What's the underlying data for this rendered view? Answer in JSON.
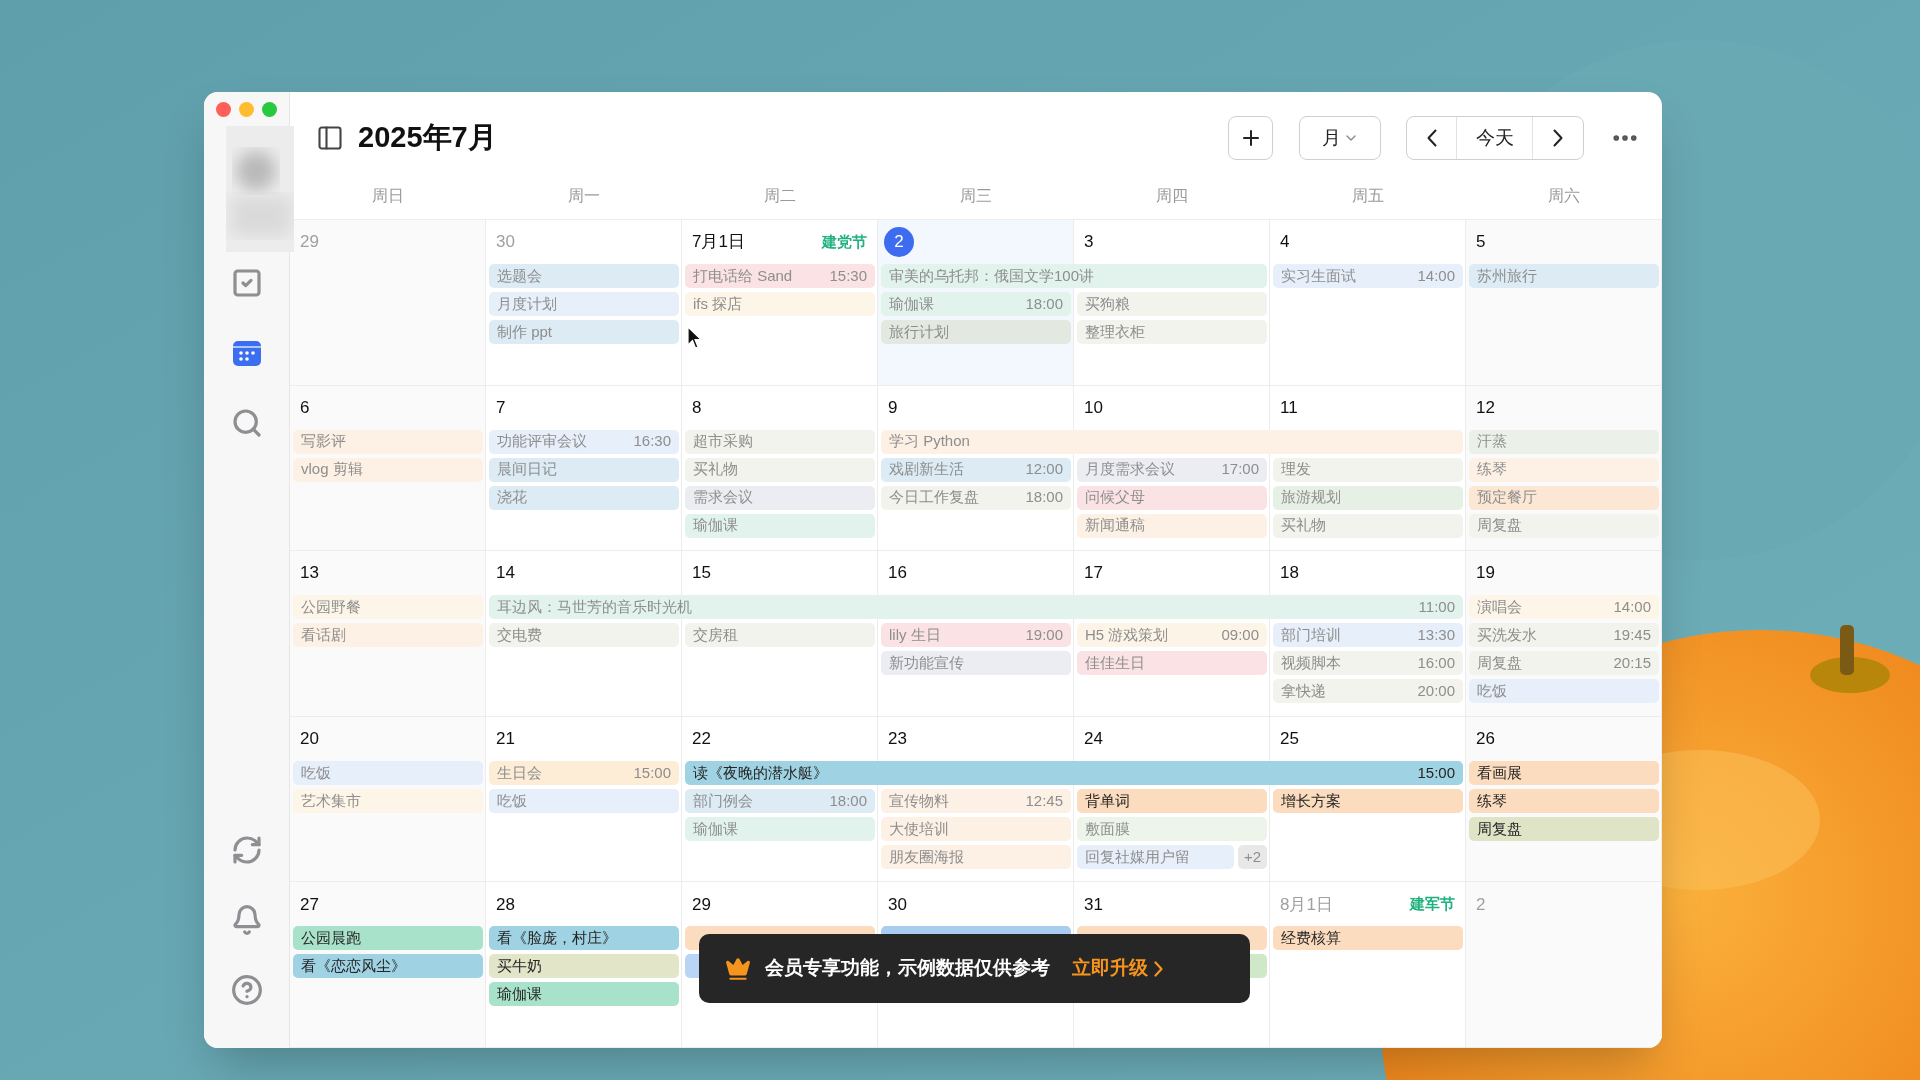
{
  "title": "2025年7月",
  "toolbar": {
    "view": "月",
    "today": "今天"
  },
  "sidebar": {
    "items": [
      {
        "kind": "tasks",
        "selected": false
      },
      {
        "kind": "calendar",
        "selected": true
      },
      {
        "kind": "search",
        "selected": false
      }
    ],
    "bottom": [
      {
        "kind": "sync"
      },
      {
        "kind": "bell"
      },
      {
        "kind": "help"
      }
    ]
  },
  "weekdays": [
    "周日",
    "周一",
    "周二",
    "周三",
    "周四",
    "周五",
    "周六"
  ],
  "weeks": [
    {
      "bands": [
        {
          "title": "审美的乌托邦：俄国文学100讲",
          "color": "#e1f3ec",
          "done": true,
          "covers": [
            false,
            false,
            false,
            true,
            true,
            false,
            false
          ]
        }
      ],
      "days": [
        {
          "date": "29",
          "muted": true
        },
        {
          "date": "30",
          "muted": true,
          "events": [
            {
              "title": "选题会",
              "color": "#dcebf4",
              "done": true
            },
            {
              "title": "月度计划",
              "color": "#e6effa",
              "done": true
            },
            {
              "title": "制作 ppt",
              "color": "#dcebf4",
              "done": true
            }
          ]
        },
        {
          "date": "7月1日",
          "muted": false,
          "holiday": "建党节",
          "events": [
            {
              "title": "打电话给 Sand",
              "time": "15:30",
              "color": "#fbe3e5",
              "done": true
            },
            {
              "title": "ifs 探店",
              "color": "#fdf6e8",
              "done": true
            }
          ]
        },
        {
          "date": "2",
          "muted": false,
          "today": true,
          "events": [
            {
              "title": "瑜伽课",
              "time": "18:00",
              "color": "#e1f3ec",
              "done": true
            },
            {
              "title": "旅行计划",
              "color": "#e3e9e1",
              "done": true
            }
          ]
        },
        {
          "date": "3",
          "muted": false,
          "events": [
            {
              "title": "买狗粮",
              "color": "#f1f3ec",
              "done": true
            },
            {
              "title": "整理衣柜",
              "color": "#f1f3ec",
              "done": true
            }
          ]
        },
        {
          "date": "4",
          "muted": false,
          "events": [
            {
              "title": "实习生面试",
              "time": "14:00",
              "color": "#e6effa",
              "done": true
            }
          ]
        },
        {
          "date": "5",
          "muted": false,
          "events": [
            {
              "title": "苏州旅行",
              "color": "#dcebf4",
              "done": true
            }
          ]
        }
      ]
    },
    {
      "bands": [
        {
          "title": "学习 Python",
          "color": "#fdf1e6",
          "done": true,
          "covers": [
            false,
            false,
            false,
            true,
            true,
            true,
            false
          ]
        }
      ],
      "days": [
        {
          "date": "6",
          "muted": false,
          "events": [
            {
              "title": "写影评",
              "color": "#fdf1e6",
              "done": true
            },
            {
              "title": "vlog 剪辑",
              "color": "#fdf1e6",
              "done": true
            }
          ]
        },
        {
          "date": "7",
          "muted": false,
          "events": [
            {
              "title": "功能评审会议",
              "time": "16:30",
              "color": "#e6effa",
              "done": true
            },
            {
              "title": "晨间日记",
              "color": "#dcebf4",
              "done": true
            },
            {
              "title": "浇花",
              "color": "#dcebf4",
              "done": true
            }
          ]
        },
        {
          "date": "8",
          "muted": false,
          "events": [
            {
              "title": "超市采购",
              "color": "#f1f3ec",
              "done": true
            },
            {
              "title": "买礼物",
              "color": "#f1f3ec",
              "done": true
            },
            {
              "title": "需求会议",
              "color": "#ecedf2",
              "done": true
            },
            {
              "title": "瑜伽课",
              "color": "#e1f3ec",
              "done": true
            }
          ]
        },
        {
          "date": "9",
          "muted": false,
          "events": [
            {
              "title": "戏剧新生活",
              "time": "12:00",
              "color": "#dcebf4",
              "done": true
            },
            {
              "title": "今日工作复盘",
              "time": "18:00",
              "color": "#f1f3ec",
              "done": true
            }
          ]
        },
        {
          "date": "10",
          "muted": false,
          "events": [
            {
              "title": "月度需求会议",
              "time": "17:00",
              "color": "#ecedf2",
              "done": true
            },
            {
              "title": "问候父母",
              "color": "#fbe3e5",
              "done": true
            },
            {
              "title": "新闻通稿",
              "color": "#fdf1e6",
              "done": true
            }
          ]
        },
        {
          "date": "11",
          "muted": false,
          "events": [
            {
              "title": "理发",
              "color": "#f1f3ec",
              "done": true
            },
            {
              "title": "旅游规划",
              "color": "#e7f0e5",
              "done": true
            },
            {
              "title": "买礼物",
              "color": "#f1f3ec",
              "done": true
            }
          ]
        },
        {
          "date": "12",
          "muted": false,
          "events": [
            {
              "title": "汗蒸",
              "color": "#ebf1e8",
              "done": true
            },
            {
              "title": "练琴",
              "color": "#fdf1e6",
              "done": true
            },
            {
              "title": "预定餐厅",
              "color": "#fce7d4",
              "done": true
            },
            {
              "title": "周复盘",
              "color": "#f1f3ec",
              "done": true
            }
          ]
        }
      ]
    },
    {
      "bands": [
        {
          "title": "耳边风：马世芳的音乐时光机",
          "time": "11:00",
          "color": "#e1f3ec",
          "done": true,
          "covers": [
            false,
            true,
            true,
            true,
            true,
            true,
            false
          ]
        }
      ],
      "days": [
        {
          "date": "13",
          "muted": false,
          "events": [
            {
              "title": "公园野餐",
              "color": "#fdf6e8",
              "done": true
            },
            {
              "title": "看话剧",
              "color": "#fdf1e6",
              "done": true
            }
          ]
        },
        {
          "date": "14",
          "muted": false,
          "events": [
            {
              "title": "交电费",
              "color": "#f1f3ec",
              "done": true
            }
          ]
        },
        {
          "date": "15",
          "muted": false,
          "events": [
            {
              "title": "交房租",
              "color": "#f1f3ec",
              "done": true
            }
          ]
        },
        {
          "date": "16",
          "muted": false,
          "events": [
            {
              "title": "lily 生日",
              "time": "19:00",
              "color": "#fbe3e5",
              "done": true
            },
            {
              "title": "新功能宣传",
              "color": "#ecedf2",
              "done": true
            }
          ]
        },
        {
          "date": "17",
          "muted": false,
          "events": [
            {
              "title": "H5 游戏策划",
              "time": "09:00",
              "color": "#fdf4e8",
              "done": true
            },
            {
              "title": "佳佳生日",
              "color": "#fbe3e5",
              "done": true
            }
          ]
        },
        {
          "date": "18",
          "muted": false,
          "events": [
            {
              "title": "部门培训",
              "time": "13:30",
              "color": "#e6effa",
              "done": true
            },
            {
              "title": "视频脚本",
              "time": "16:00",
              "color": "#f1f3ec",
              "done": true
            },
            {
              "title": "拿快递",
              "time": "20:00",
              "color": "#f1f3ec",
              "done": true
            }
          ]
        },
        {
          "date": "19",
          "muted": false,
          "events": [
            {
              "title": "演唱会",
              "time": "14:00",
              "color": "#fdf6e8",
              "done": true
            },
            {
              "title": "买洗发水",
              "time": "19:45",
              "color": "#f1f3ec",
              "done": true
            },
            {
              "title": "周复盘",
              "time": "20:15",
              "color": "#f1f3ec",
              "done": true
            },
            {
              "title": "吃饭",
              "color": "#e6effa",
              "done": true
            }
          ]
        }
      ]
    },
    {
      "bands": [
        {
          "title": "读《夜晚的潜水艇》",
          "time": "15:00",
          "color": "#9fd2e2",
          "done": false,
          "covers": [
            false,
            false,
            true,
            true,
            true,
            true,
            false
          ]
        }
      ],
      "days": [
        {
          "date": "20",
          "muted": false,
          "events": [
            {
              "title": "吃饭",
              "color": "#e6effa",
              "done": true
            },
            {
              "title": "艺术集市",
              "color": "#fdf6e8",
              "done": true
            }
          ]
        },
        {
          "date": "21",
          "muted": false,
          "events": [
            {
              "title": "生日会",
              "time": "15:00",
              "color": "#fdecd6",
              "done": true
            },
            {
              "title": "吃饭",
              "color": "#e6effa",
              "done": true
            }
          ]
        },
        {
          "date": "22",
          "muted": false,
          "events": [
            {
              "title": "部门例会",
              "time": "18:00",
              "color": "#dcebf4",
              "done": true
            },
            {
              "title": "瑜伽课",
              "color": "#e1f3ec",
              "done": true
            }
          ]
        },
        {
          "date": "23",
          "muted": false,
          "events": [
            {
              "title": "宣传物料",
              "time": "12:45",
              "color": "#fdf1e6",
              "done": true
            },
            {
              "title": "大使培训",
              "color": "#fdf1e6",
              "done": true
            },
            {
              "title": "朋友圈海报",
              "color": "#fdf1e6",
              "done": true
            }
          ]
        },
        {
          "date": "24",
          "muted": false,
          "more": "+2",
          "events": [
            {
              "title": "背单词",
              "color": "#fbdcbe",
              "done": false
            },
            {
              "title": "敷面膜",
              "color": "#edf4ea",
              "done": true
            },
            {
              "title": "回复社媒用户留",
              "color": "#e6effa",
              "done": true
            }
          ]
        },
        {
          "date": "25",
          "muted": false,
          "events": [
            {
              "title": "增长方案",
              "color": "#fbdcbe",
              "done": false
            }
          ]
        },
        {
          "date": "26",
          "muted": false,
          "events": [
            {
              "title": "看画展",
              "color": "#fbdcbe",
              "done": false
            },
            {
              "title": "练琴",
              "color": "#fbdcbe",
              "done": false
            },
            {
              "title": "周复盘",
              "color": "#dfe4c6",
              "done": false
            }
          ]
        }
      ]
    },
    {
      "days": [
        {
          "date": "27",
          "muted": false,
          "events": [
            {
              "title": "公园晨跑",
              "color": "#a8e2cb",
              "done": false
            },
            {
              "title": "看《恋恋风尘》",
              "color": "#9fd2e2",
              "done": false
            }
          ]
        },
        {
          "date": "28",
          "muted": false,
          "events": [
            {
              "title": "看《脸庞，村庄》",
              "color": "#9fd2e2",
              "done": false
            },
            {
              "title": "买牛奶",
              "color": "#e2e5c8",
              "done": false
            },
            {
              "title": "瑜伽课",
              "color": "#a8e2cb",
              "done": false
            }
          ]
        },
        {
          "date": "29",
          "muted": false,
          "events": [
            {
              "color": "#fbdcbe"
            },
            {
              "color": "#b9d4f4"
            }
          ]
        },
        {
          "date": "30",
          "muted": false,
          "events": [
            {
              "color": "#a9cdf0"
            }
          ]
        },
        {
          "date": "31",
          "muted": false,
          "events": [
            {
              "color": "#fbdcbe"
            },
            {
              "color": "#cfe8c8"
            }
          ]
        },
        {
          "date": "8月1日",
          "muted": true,
          "holiday": "建军节",
          "events": [
            {
              "title": "经费核算",
              "color": "#fbdcbe",
              "done": false
            }
          ]
        },
        {
          "date": "2",
          "muted": true
        }
      ]
    }
  ],
  "toast": {
    "message": "会员专享功能，示例数据仅供参考",
    "action": "立即升级"
  }
}
